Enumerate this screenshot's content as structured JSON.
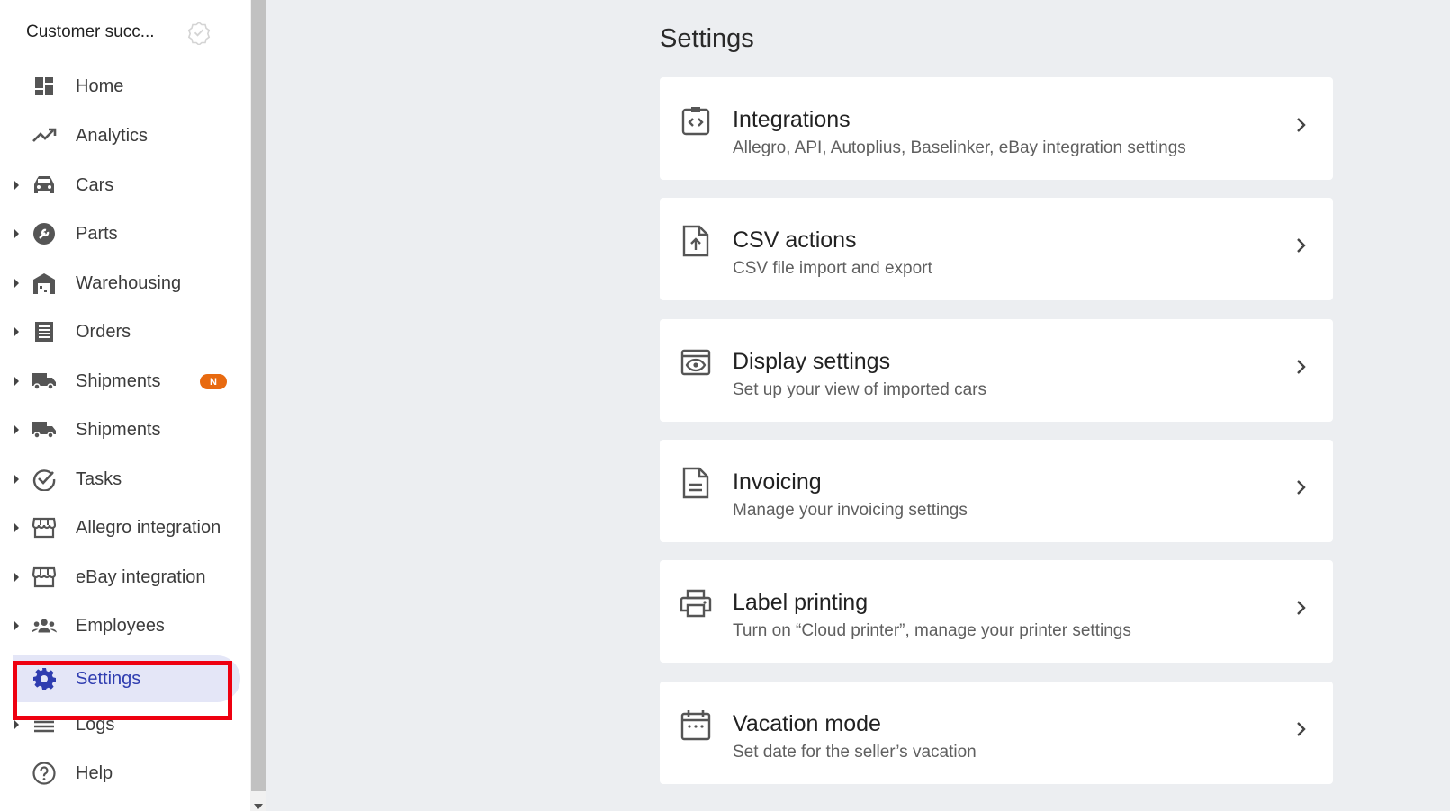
{
  "sidebar": {
    "workspace_name": "Customer succ...",
    "items": [
      {
        "label": "Home",
        "icon": "dashboard-icon",
        "has_caret": false
      },
      {
        "label": "Analytics",
        "icon": "trending-up-icon",
        "has_caret": false
      },
      {
        "label": "Cars",
        "icon": "car-icon",
        "has_caret": true
      },
      {
        "label": "Parts",
        "icon": "wrench-icon",
        "has_caret": true
      },
      {
        "label": "Warehousing",
        "icon": "warehouse-icon",
        "has_caret": true
      },
      {
        "label": "Orders",
        "icon": "receipt-icon",
        "has_caret": true
      },
      {
        "label": "Shipments",
        "icon": "truck-icon",
        "has_caret": true,
        "badge": "N"
      },
      {
        "label": "Shipments",
        "icon": "truck-icon",
        "has_caret": true
      },
      {
        "label": "Tasks",
        "icon": "check-circle-icon",
        "has_caret": true
      },
      {
        "label": "Allegro integration",
        "icon": "storefront-icon",
        "has_caret": true
      },
      {
        "label": "eBay integration",
        "icon": "storefront-icon",
        "has_caret": true
      },
      {
        "label": "Employees",
        "icon": "people-icon",
        "has_caret": true
      },
      {
        "label": "Settings",
        "icon": "gear-icon",
        "has_caret": false,
        "active": true
      },
      {
        "label": "Logs",
        "icon": "list-icon",
        "has_caret": true
      },
      {
        "label": "Help",
        "icon": "help-circle-icon",
        "has_caret": false
      }
    ]
  },
  "main": {
    "title": "Settings",
    "cards": [
      {
        "title": "Integrations",
        "description": "Allegro, API, Autoplius, Baselinker, eBay integration settings",
        "icon": "code-clipboard-icon"
      },
      {
        "title": "CSV actions",
        "description": "CSV file import and export",
        "icon": "file-upload-icon"
      },
      {
        "title": "Display settings",
        "description": "Set up your view of imported cars",
        "icon": "preview-eye-icon"
      },
      {
        "title": "Invoicing",
        "description": "Manage your invoicing settings",
        "icon": "document-icon"
      },
      {
        "title": "Label printing",
        "description": "Turn on “Cloud printer”, manage your printer settings",
        "icon": "printer-icon"
      },
      {
        "title": "Vacation mode",
        "description": "Set date for the seller’s vacation",
        "icon": "calendar-icon"
      }
    ]
  },
  "colors": {
    "accent": "#2f3db0",
    "active_bg": "#e4e6f7",
    "badge": "#e86a10",
    "highlight": "#ee0010",
    "page_bg": "#eceef1"
  }
}
